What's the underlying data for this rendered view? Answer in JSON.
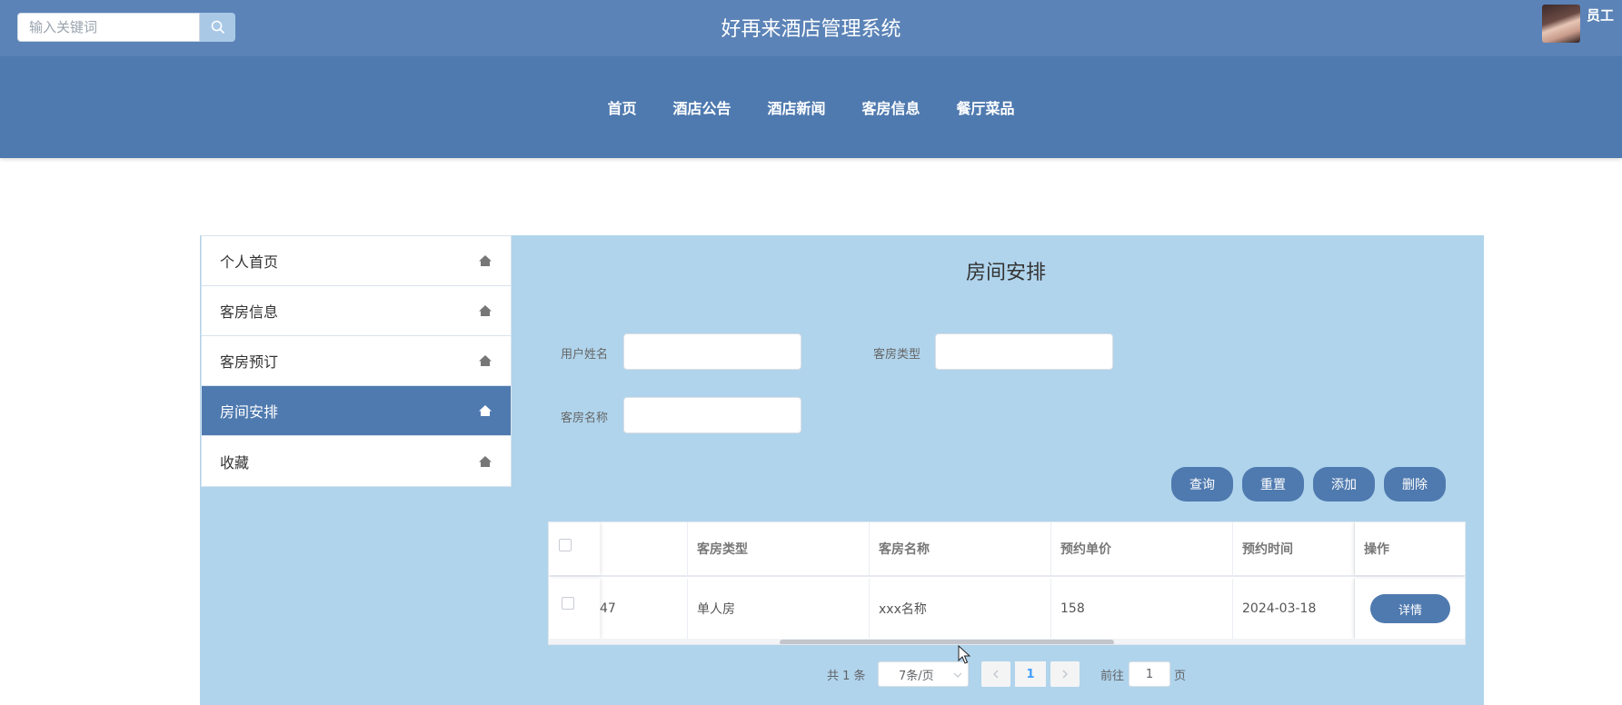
{
  "header": {
    "search_placeholder": "输入关键词",
    "site_title": "好再来酒店管理系统",
    "user_name": "员工"
  },
  "nav": {
    "items": [
      "首页",
      "酒店公告",
      "酒店新闻",
      "客房信息",
      "餐厅菜品"
    ]
  },
  "sidebar": {
    "items": [
      {
        "label": "个人首页",
        "active": false
      },
      {
        "label": "客房信息",
        "active": false
      },
      {
        "label": "客房预订",
        "active": false
      },
      {
        "label": "房间安排",
        "active": true
      },
      {
        "label": "收藏",
        "active": false
      }
    ]
  },
  "panel": {
    "title": "房间安排",
    "filters": {
      "username_label": "用户姓名",
      "roomtype_label": "客房类型",
      "roomname_label": "客房名称"
    },
    "buttons": {
      "query": "查询",
      "reset": "重置",
      "add": "添加",
      "delete": "删除"
    }
  },
  "table": {
    "columns": [
      "",
      "客房类型",
      "客房名称",
      "预约单价",
      "预约时间",
      "操作"
    ],
    "rows": [
      {
        "partial_id": "47",
        "room_type": "单人房",
        "room_name": "xxx名称",
        "price": "158",
        "time": "2024-03-18",
        "action": "详情"
      }
    ]
  },
  "pagination": {
    "total": "共 1 条",
    "page_size": "7条/页",
    "current_page": "1",
    "goto_label": "前往",
    "goto_value": "1",
    "page_suffix": "页"
  },
  "colors": {
    "topbar": "#5b83b7",
    "navband": "#4f7aaf",
    "content_bg": "#b0d4ec",
    "accent": "#4f7aaf",
    "link": "#409eff"
  }
}
